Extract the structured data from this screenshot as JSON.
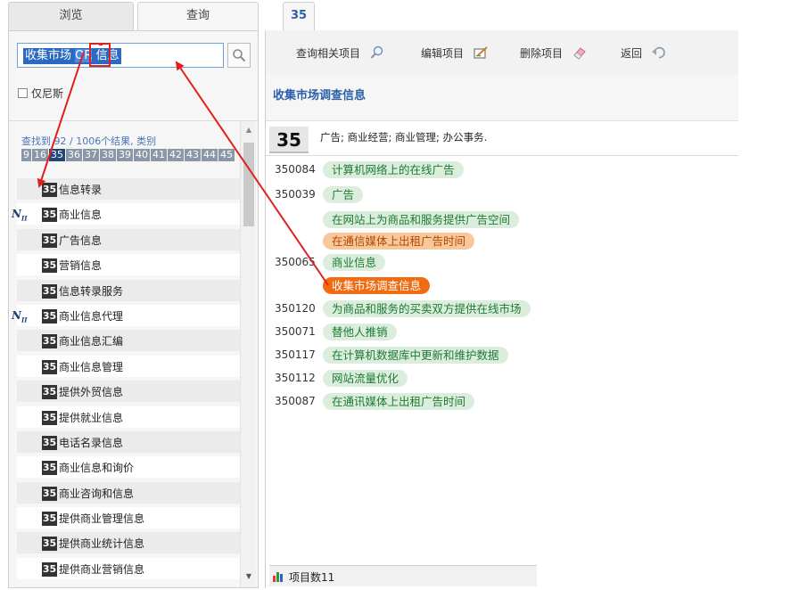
{
  "left_panel": {
    "tabs": {
      "browse": "浏览",
      "search": "查询"
    },
    "search": {
      "text_before": "收集市场",
      "text_or": "OR",
      "text_after": "信息"
    },
    "only_nice_label": "仅尼斯",
    "result_summary": "查找到 92 / 1006个结果, 类别",
    "class_chips": [
      "9",
      "16",
      "35",
      "36",
      "37",
      "38",
      "39",
      "40",
      "41",
      "42",
      "43",
      "44",
      "45"
    ],
    "selected_class": "35",
    "results": [
      {
        "badge": "35",
        "label": "信息转录",
        "nice": false
      },
      {
        "badge": "35",
        "label": "商业信息",
        "nice": true,
        "nice_mark": "N",
        "nice_sub": "II"
      },
      {
        "badge": "35",
        "label": "广告信息",
        "nice": false
      },
      {
        "badge": "35",
        "label": "营销信息",
        "nice": false
      },
      {
        "badge": "35",
        "label": "信息转录服务",
        "nice": false
      },
      {
        "badge": "35",
        "label": "商业信息代理",
        "nice": true,
        "nice_mark": "N",
        "nice_sub": "II"
      },
      {
        "badge": "35",
        "label": "商业信息汇编",
        "nice": false
      },
      {
        "badge": "35",
        "label": "商业信息管理",
        "nice": false
      },
      {
        "badge": "35",
        "label": "提供外贸信息",
        "nice": false
      },
      {
        "badge": "35",
        "label": "提供就业信息",
        "nice": false
      },
      {
        "badge": "35",
        "label": "电话名录信息",
        "nice": false
      },
      {
        "badge": "35",
        "label": "商业信息和询价",
        "nice": false
      },
      {
        "badge": "35",
        "label": "商业咨询和信息",
        "nice": false
      },
      {
        "badge": "35",
        "label": "提供商业管理信息",
        "nice": false
      },
      {
        "badge": "35",
        "label": "提供商业统计信息",
        "nice": false
      },
      {
        "badge": "35",
        "label": "提供商业营销信息",
        "nice": false
      }
    ]
  },
  "right_panel": {
    "tab_label": "35",
    "toolbar": {
      "query_related": "查询相关项目",
      "edit": "编辑项目",
      "delete": "删除项目",
      "back": "返回"
    },
    "page_title": "收集市场调查信息",
    "class_number": "35",
    "class_description": "广告; 商业经营; 商业管理; 办公事务.",
    "items": [
      {
        "code": "350084",
        "label": "计算机网络上的在线广告",
        "style": "green"
      },
      {
        "code": "350039",
        "label": "广告",
        "style": "green"
      },
      {
        "code": "",
        "label": "在网站上为商品和服务提供广告空间",
        "style": "green"
      },
      {
        "code": "",
        "label": "在通信媒体上出租广告时间",
        "style": "orange-light"
      },
      {
        "code": "350065",
        "label": "商业信息",
        "style": "green"
      },
      {
        "code": "",
        "label": "收集市场调查信息",
        "style": "orange"
      },
      {
        "code": "350120",
        "label": "为商品和服务的买卖双方提供在线市场",
        "style": "green"
      },
      {
        "code": "350071",
        "label": "替他人推销",
        "style": "green"
      },
      {
        "code": "350117",
        "label": "在计算机数据库中更新和维护数据",
        "style": "green"
      },
      {
        "code": "350112",
        "label": "网站流量优化",
        "style": "green"
      },
      {
        "code": "350087",
        "label": "在通讯媒体上出租广告时间",
        "style": "green"
      }
    ],
    "footer": "项目数11"
  },
  "colors": {
    "accent_blue": "#2b5fa8",
    "pill_green_bg": "#dbeedd",
    "pill_orange": "#f16b11",
    "annotation_red": "#e0201e"
  }
}
